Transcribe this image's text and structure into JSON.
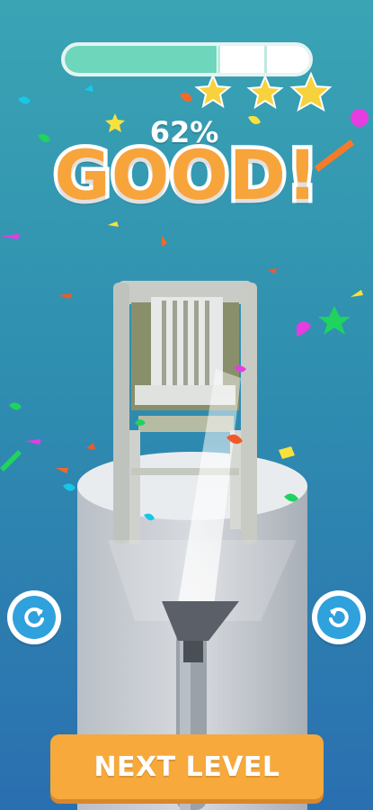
{
  "hud": {
    "progress_percent": 62,
    "progress_fraction": 0.62,
    "percent_label": "62%",
    "rating_label": "GOOD!",
    "stars_earned": 3,
    "stars_total": 3
  },
  "controls": {
    "left_icon": "rotate-left-icon",
    "right_icon": "rotate-right-icon",
    "next_level_label": "NEXT LEVEL"
  },
  "colors": {
    "background_top": "#3aa4b4",
    "background_bottom": "#2a6fb0",
    "progress_fill": "#6dd6bb",
    "star": "#f7d23c",
    "rating_text": "#f7a43a",
    "button": "#f7a93c",
    "icon_button": "#2fa1dc"
  }
}
